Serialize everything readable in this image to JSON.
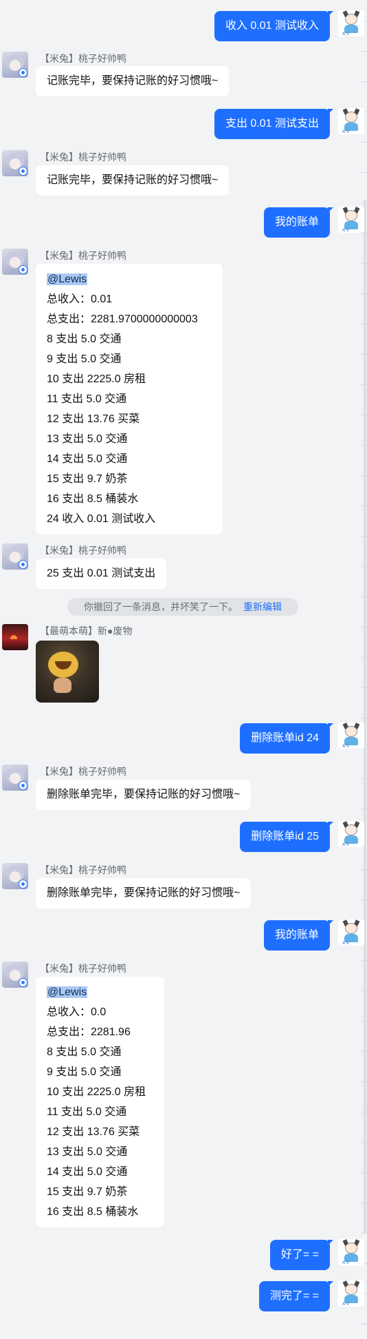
{
  "messages": {
    "m1": {
      "text": "收入 0.01 测试收入"
    },
    "m2": {
      "sender": "【米兔】桃子好帅鸭",
      "text": "记账完毕，要保持记账的好习惯哦~"
    },
    "m3": {
      "text": "支出 0.01 测试支出"
    },
    "m4": {
      "sender": "【米兔】桃子好帅鸭",
      "text": "记账完毕，要保持记账的好习惯哦~"
    },
    "m5": {
      "text": "我的账单"
    },
    "m6": {
      "sender": "【米兔】桃子好帅鸭",
      "mention": "@Lewis",
      "lines": [
        "总收入：0.01",
        "总支出：2281.9700000000003",
        "8 支出 5.0 交通",
        "9 支出 5.0 交通",
        "10 支出 2225.0 房租",
        "11 支出 5.0 交通",
        "12 支出 13.76 买菜",
        "13 支出 5.0 交通",
        "14 支出 5.0 交通",
        "15 支出 9.7 奶茶",
        "16 支出 8.5 桶装水",
        "24 收入 0.01 测试收入"
      ]
    },
    "m7": {
      "sender": "【米兔】桃子好帅鸭",
      "text": "25 支出 0.01 测试支出"
    },
    "system": {
      "text": "你撤回了一条消息，并坏笑了一下。",
      "action": "重新编辑"
    },
    "m8": {
      "sender": "【最萌本萌】新●废物"
    },
    "m9": {
      "text": "删除账单id 24"
    },
    "m10": {
      "sender": "【米兔】桃子好帅鸭",
      "text": "删除账单完毕，要保持记账的好习惯哦~"
    },
    "m11": {
      "text": "删除账单id 25"
    },
    "m12": {
      "sender": "【米兔】桃子好帅鸭",
      "text": "删除账单完毕，要保持记账的好习惯哦~"
    },
    "m13": {
      "text": "我的账单"
    },
    "m14": {
      "sender": "【米兔】桃子好帅鸭",
      "mention": "@Lewis",
      "lines": [
        "总收入：0.0",
        "总支出：2281.96",
        "8 支出 5.0 交通",
        "9 支出 5.0 交通",
        "10 支出 2225.0 房租",
        "11 支出 5.0 交通",
        "12 支出 13.76 买菜",
        "13 支出 5.0 交通",
        "14 支出 5.0 交通",
        "15 支出 9.7 奶茶",
        "16 支出 8.5 桶装水"
      ]
    },
    "m15": {
      "text": "好了= ="
    },
    "m16": {
      "text": "测完了= ="
    }
  },
  "icons": {
    "bot_avatar": "anime-character-avatar",
    "self_avatar": "cartoon-kid-avatar",
    "other_avatar": "red-sunset-avatar",
    "sticker": "laughing-face-sticker"
  },
  "colors": {
    "self_bubble": "#1e6fff",
    "other_bubble": "#ffffff",
    "background": "#f2f3f5",
    "link": "#1e6fff"
  }
}
